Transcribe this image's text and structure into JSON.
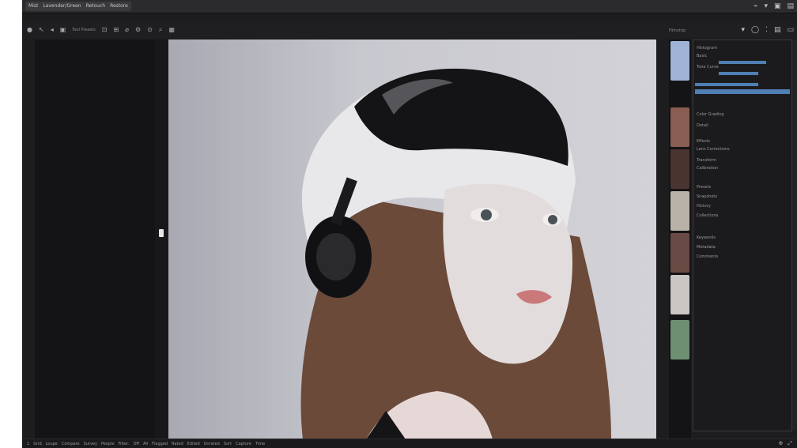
{
  "titlebar": {
    "menu": [
      "Mist",
      "Lavender/Green",
      "Retouch",
      "Restore"
    ],
    "icons": [
      "plugin-icon",
      "minimize-icon",
      "window-icon",
      "close-icon"
    ]
  },
  "toolbar": {
    "tools": [
      "move-icon",
      "brush-icon",
      "selection-icon",
      "frame-icon",
      "text-label",
      "grid-icon",
      "crop-icon",
      "lasso-icon",
      "settings-icon",
      "filter-icon",
      "zoom-icon",
      "layer-icon",
      "adjust-icon",
      "mask-icon"
    ],
    "text": "Tool Presets",
    "right": [
      "dropdown-icon",
      "circle-icon",
      "dots-icon",
      "layout-icon",
      "panel-icon"
    ]
  },
  "filmstrip": {
    "label": "Filmstrip",
    "thumbs": [
      {
        "icon": "portrait-thumbnail",
        "color": "#9fb3d6"
      },
      {
        "icon": "portrait-thumbnail",
        "color": "#8a5d52"
      },
      {
        "icon": "portrait-thumbnail",
        "color": "#4a3430"
      },
      {
        "icon": "portrait-thumbnail",
        "color": "#b9b2a8"
      },
      {
        "icon": "portrait-thumbnail",
        "color": "#6a4a44"
      },
      {
        "icon": "portrait-thumbnail",
        "color": "#c9c6c3"
      },
      {
        "icon": "landscape-thumbnail",
        "color": "#6f8f72"
      }
    ]
  },
  "sidepanel": {
    "rows": [
      "Histogram",
      "Basic",
      "Tone Curve",
      "",
      "",
      "",
      "Color Grading",
      "Detail",
      "Effects",
      "Lens Corrections",
      "Transform",
      "Calibration",
      "",
      "Presets",
      "Snapshots",
      "History",
      "Collections",
      "",
      "",
      "Keywords",
      "Metadata",
      "Comments"
    ]
  },
  "statusbar": {
    "items": [
      "1",
      "Grid",
      "Loupe",
      "Compare",
      "Survey",
      "People",
      "Filter:",
      "Off",
      "All",
      "Flagged",
      "Rated",
      "Edited",
      "Unrated",
      "Sort",
      "Capture",
      "Time"
    ],
    "right": [
      "zoom-icon",
      "fit-icon"
    ]
  },
  "colors": {
    "accent": "#4f7fb3",
    "background": "#1d1d1f",
    "canvas": "#c8c8cf"
  }
}
